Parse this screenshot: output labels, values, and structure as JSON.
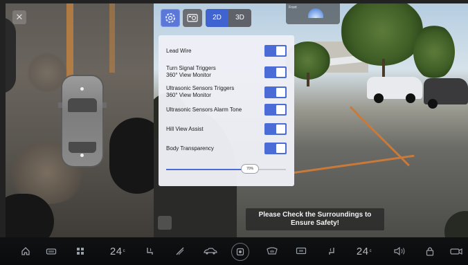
{
  "toolbar": {
    "view_2d": "2D",
    "view_3d": "3D",
    "active_view": "2D"
  },
  "front_camera": {
    "label": "Front"
  },
  "settings_panel": {
    "items": [
      {
        "label_line1": "Lead Wire",
        "label_line2": "",
        "enabled": true
      },
      {
        "label_line1": "Turn Signal Triggers",
        "label_line2": "360° View Monitor",
        "enabled": true
      },
      {
        "label_line1": "Ultrasonic Sensors Triggers",
        "label_line2": "360° View Monitor",
        "enabled": true
      },
      {
        "label_line1": "Ultrasonic Sensors Alarm Tone",
        "label_line2": "",
        "enabled": true
      },
      {
        "label_line1": "Hill View Assist",
        "label_line2": "",
        "enabled": true
      },
      {
        "label_line1": "Body Transparency",
        "label_line2": "",
        "enabled": true
      }
    ],
    "transparency": {
      "value_label": "70%",
      "fraction": 0.7
    }
  },
  "warning": {
    "line1": "Please Check the Surroundings to",
    "line2": "Ensure Safety!"
  },
  "bottom_bar": {
    "left_temp": "24",
    "right_temp": "24",
    "temp_unit": "c"
  },
  "colors": {
    "accent": "#4b6cd6",
    "panel_bg": "#eef0f6",
    "bar_bg": "#0c0d0f"
  }
}
